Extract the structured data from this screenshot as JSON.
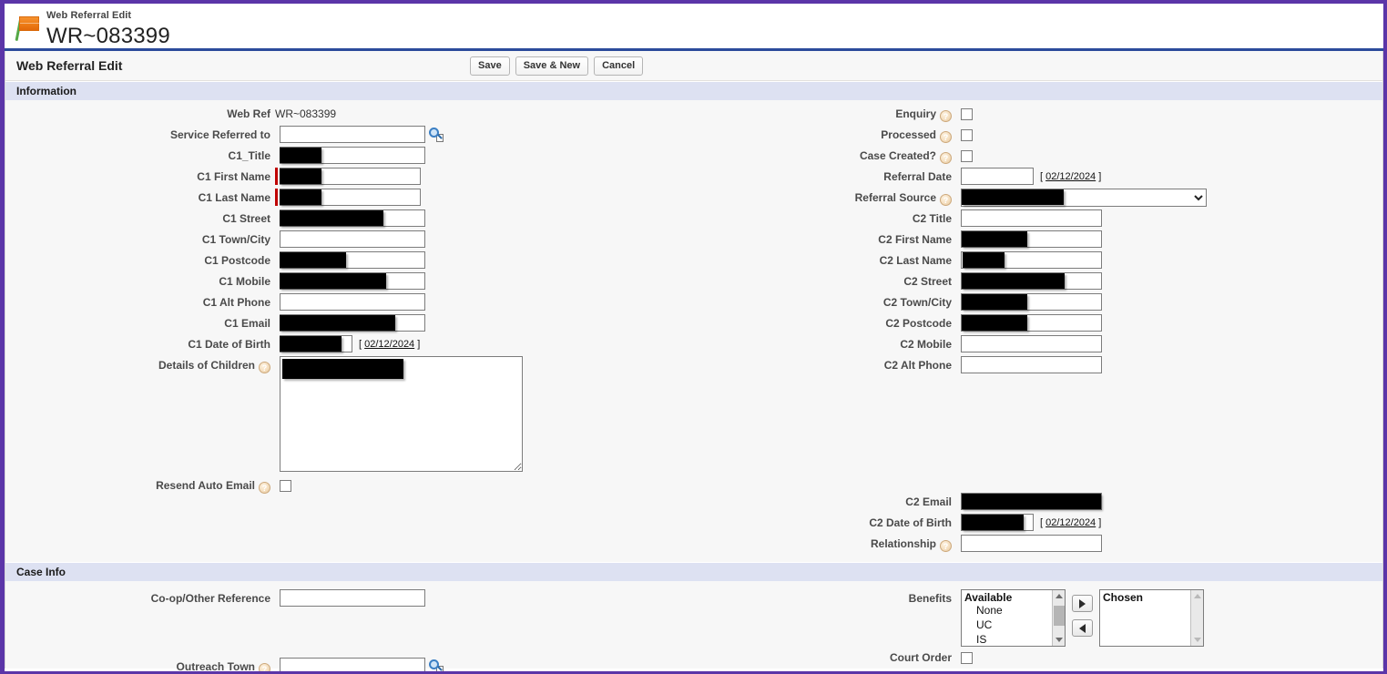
{
  "record": {
    "kicker": "Web Referral Edit",
    "id": "WR~083399",
    "flag_icon": "flag-icon"
  },
  "pageblock": {
    "title": "Web Referral Edit",
    "buttons": {
      "save": "Save",
      "save_new": "Save & New",
      "cancel": "Cancel"
    }
  },
  "sections": {
    "information": "Information",
    "case_info": "Case Info"
  },
  "information": {
    "left": {
      "web_ref_label": "Web Ref",
      "web_ref_value": "WR~083399",
      "service_referred_label": "Service Referred to",
      "service_referred_value": "",
      "c1_title_label": "C1_Title",
      "c1_title_value": "",
      "c1_first_name_label": "C1 First Name",
      "c1_first_name_value": "",
      "c1_last_name_label": "C1 Last Name",
      "c1_last_name_value": "",
      "c1_street_label": "C1 Street",
      "c1_street_value": "",
      "c1_town_label": "C1 Town/City",
      "c1_town_value": "",
      "c1_postcode_label": "C1 Postcode",
      "c1_postcode_value": "",
      "c1_mobile_label": "C1 Mobile",
      "c1_mobile_value": "",
      "c1_alt_phone_label": "C1 Alt Phone",
      "c1_alt_phone_value": "",
      "c1_email_label": "C1 Email",
      "c1_email_value": "",
      "c1_dob_label": "C1 Date of Birth",
      "c1_dob_value": "",
      "c1_dob_hint": "02/12/2024",
      "details_children_label": "Details of Children",
      "details_children_value": "",
      "resend_auto_email_label": "Resend Auto Email",
      "resend_auto_email_checked": false
    },
    "right": {
      "enquiry_label": "Enquiry",
      "enquiry_checked": false,
      "processed_label": "Processed",
      "processed_checked": false,
      "case_created_label": "Case Created?",
      "case_created_checked": false,
      "referral_date_label": "Referral Date",
      "referral_date_value": "",
      "referral_date_hint": "02/12/2024",
      "referral_source_label": "Referral Source",
      "referral_source_value": "",
      "c2_title_label": "C2 Title",
      "c2_title_value": "",
      "c2_first_name_label": "C2 First Name",
      "c2_first_name_value": "",
      "c2_last_name_label": "C2 Last Name",
      "c2_last_name_value": "",
      "c2_street_label": "C2 Street",
      "c2_street_value": "",
      "c2_town_label": "C2 Town/City",
      "c2_town_value": "",
      "c2_postcode_label": "C2 Postcode",
      "c2_postcode_value": "",
      "c2_mobile_label": "C2 Mobile",
      "c2_mobile_value": "",
      "c2_alt_phone_label": "C2 Alt Phone",
      "c2_alt_phone_value": "",
      "c2_email_label": "C2 Email",
      "c2_email_value": "",
      "c2_dob_label": "C2 Date of Birth",
      "c2_dob_value": "",
      "c2_dob_hint": "02/12/2024",
      "relationship_label": "Relationship",
      "relationship_value": ""
    }
  },
  "case_info": {
    "left": {
      "coop_reference_label": "Co-op/Other Reference",
      "coop_reference_value": "",
      "outreach_town_label": "Outreach Town",
      "outreach_town_value": ""
    },
    "right": {
      "benefits_label": "Benefits",
      "available_header": "Available",
      "available_options": [
        "None",
        "UC",
        "IS"
      ],
      "chosen_header": "Chosen",
      "chosen_options": [],
      "add_button": "add-to-chosen",
      "remove_button": "remove-from-chosen",
      "court_order_label": "Court Order",
      "court_order_checked": false
    }
  },
  "icons": {
    "help": "?",
    "lookup": "lookup-icon"
  },
  "colors": {
    "frame": "#5b35a8",
    "header_rule": "#2b4b9b",
    "section_header_bg": "#dde1f2",
    "required_marker": "#c00000",
    "redaction": "#000000"
  }
}
